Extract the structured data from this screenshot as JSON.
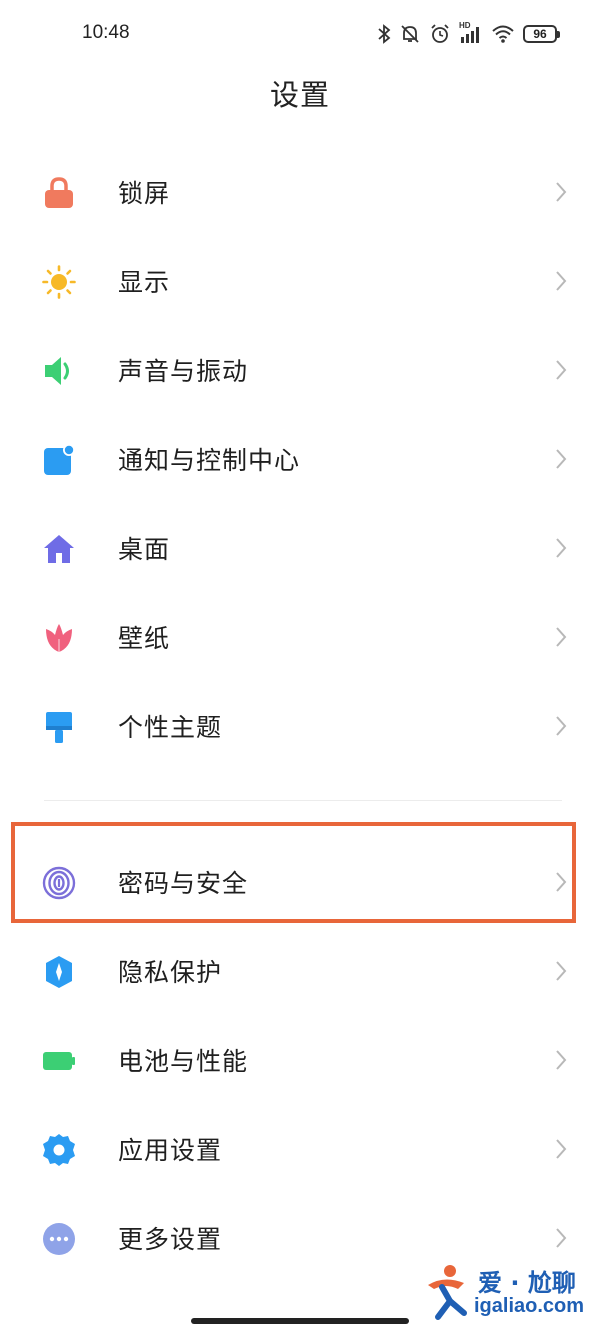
{
  "status": {
    "time": "10:48",
    "network_badge": "HD",
    "battery": "96"
  },
  "title": "设置",
  "menu": [
    {
      "label": "锁屏",
      "icon": "lock-icon",
      "color": "#f07a5e"
    },
    {
      "label": "显示",
      "icon": "sun-icon",
      "color": "#f7b928"
    },
    {
      "label": "声音与振动",
      "icon": "speaker-icon",
      "color": "#3ccf74"
    },
    {
      "label": "通知与控制中心",
      "icon": "notification-icon",
      "color": "#2b9cf2"
    },
    {
      "label": "桌面",
      "icon": "home-icon",
      "color": "#6f6ce6"
    },
    {
      "label": "壁纸",
      "icon": "tulip-icon",
      "color": "#f0617e"
    },
    {
      "label": "个性主题",
      "icon": "paint-roller-icon",
      "color": "#2b9cf2"
    },
    {
      "label": "密码与安全",
      "icon": "fingerprint-icon",
      "color": "#7c6fd9"
    },
    {
      "label": "隐私保护",
      "icon": "shield-icon",
      "color": "#2b9cf2"
    },
    {
      "label": "电池与性能",
      "icon": "battery-icon",
      "color": "#3ccf74"
    },
    {
      "label": "应用设置",
      "icon": "gear-icon",
      "color": "#2b9cf2"
    },
    {
      "label": "更多设置",
      "icon": "more-icon",
      "color": "#8fa3e8"
    }
  ],
  "highlight_color": "#e8663a",
  "watermark": {
    "line1": "爱 · 尬聊",
    "line2": "igaliao.com"
  }
}
